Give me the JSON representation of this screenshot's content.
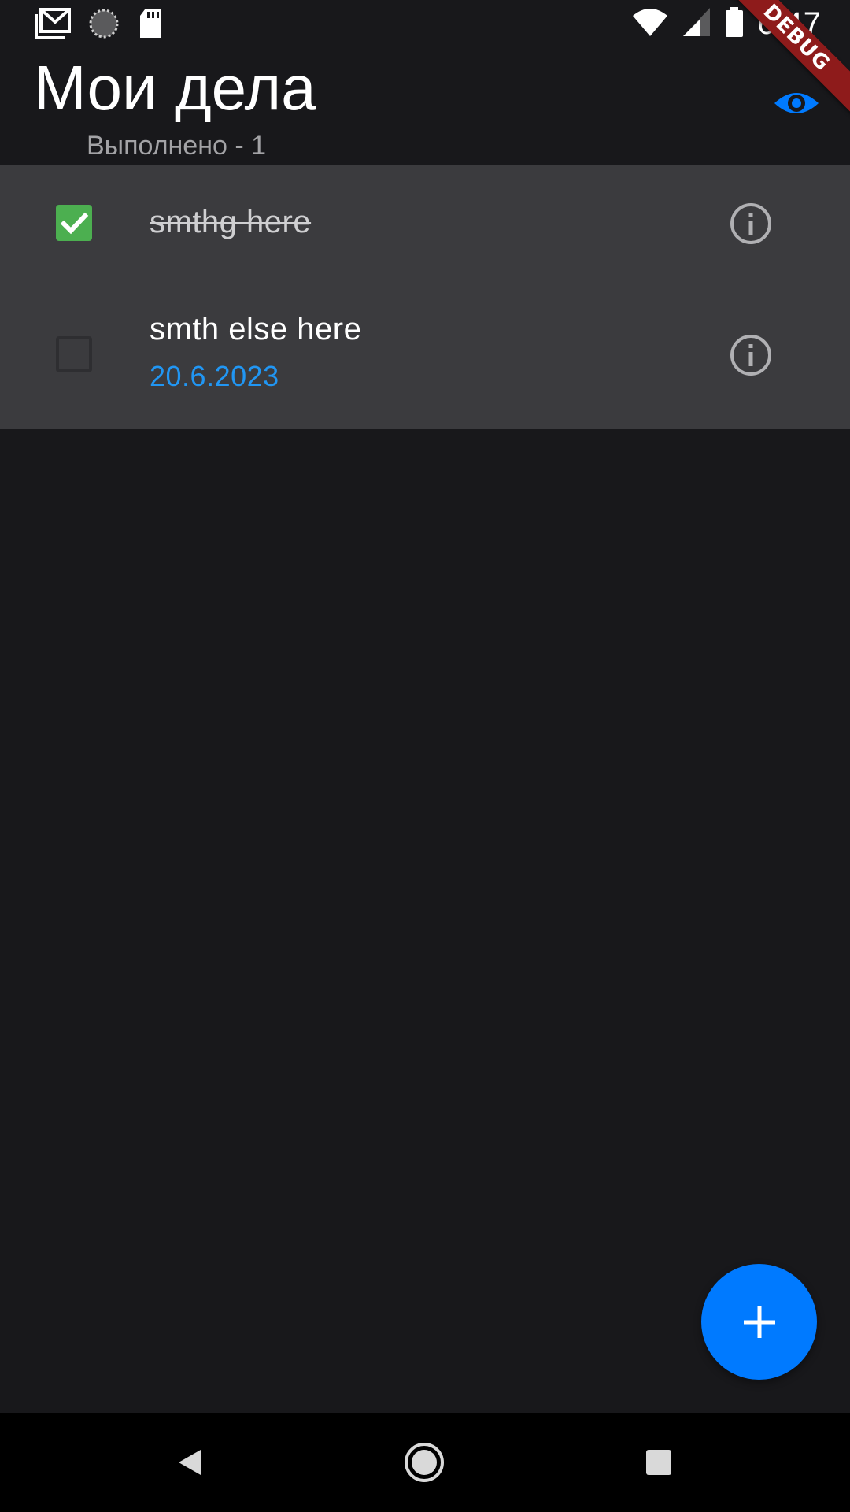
{
  "status_bar": {
    "time": "6:47",
    "left_icons": [
      "gmail-icon",
      "sync-icon",
      "sd-card-icon"
    ],
    "right_icons": [
      "wifi-icon",
      "cell-signal-icon",
      "battery-icon"
    ]
  },
  "debug_banner": {
    "label": "DEBUG"
  },
  "header": {
    "title": "Мои дела",
    "done_counter": "Выполнено - 1",
    "visibility_icon": "eye-icon"
  },
  "tasks": [
    {
      "title": "smthg here",
      "done": true,
      "date": ""
    },
    {
      "title": "smth else here",
      "done": false,
      "date": "20.6.2023"
    }
  ],
  "fab": {
    "icon": "plus-icon"
  },
  "nav_bar": {
    "icons": [
      "back-icon",
      "home-icon",
      "recents-icon"
    ]
  },
  "colors": {
    "background": "#18181b",
    "list_background": "#3b3b3e",
    "accent": "#007aff",
    "checkbox_checked": "#4caf50",
    "date": "#2196f3",
    "debug": "#8e1b1b"
  }
}
